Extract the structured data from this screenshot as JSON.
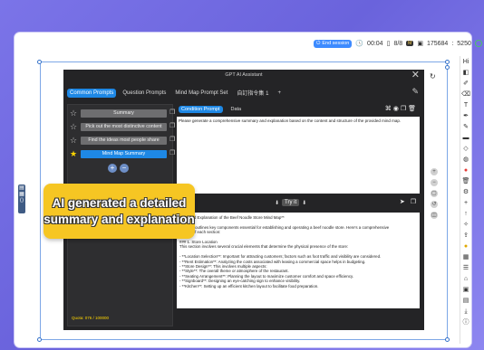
{
  "status_bar": {
    "end_label": "End session",
    "timer": "00:04",
    "pages": "8/8",
    "coin_label": "M",
    "credits": "175684",
    "sep": ":",
    "rate": "5250"
  },
  "app": {
    "title": "GPT AI Assistant",
    "tabs": [
      "Common Prompts",
      "Question Prompts",
      "Mind Map Prompt Set",
      "自訂指令集 1"
    ],
    "add_tab": "+",
    "prompts": [
      {
        "label": "Summary",
        "starred": false
      },
      {
        "label": "Pick out the most distinctive content",
        "starred": false
      },
      {
        "label": "Find the ideas most people share",
        "starred": false
      },
      {
        "label": "Mind Map Summary",
        "starred": true
      }
    ],
    "quota_text": "Quota: 076 / 100000",
    "right_tabs": [
      "Condition Prompt",
      "Data"
    ],
    "condition_text": "Please generate a comprehensive summary and explanation based on the content and structure of the provided mind map.",
    "try_it_label": "Try it",
    "result_lines": [
      "...ary and Explanation of the Beef Noodle Store Mind Map**",
      "",
      "...d map outlines key components essential for establishing and operating a beef noodle store. Here's a comprehensive",
      "...mary of each section:",
      "",
      "### 1. Store Location",
      "This section involves several crucial elements that determine the physical presence of the store:",
      "",
      "- **Location Selection**: Important for attracting customers; factors such as foot traffic and visibility are considered.",
      "- **Rent Estimation**: Analyzing the costs associated with leasing a commercial space helps in budgeting.",
      "- **Store Design**: This involves multiple aspects:",
      "   - **Style**: The overall theme or atmosphere of the restaurant.",
      "   - **Seating Arrangement**: Planning the layout to maximize customer comfort and space efficiency.",
      "   - **Signboard**: Designing an eye-catching sign to enhance visibility.",
      "   - **Kitchen**: Setting up an efficient kitchen layout to facilitate food preparation."
    ]
  },
  "callout": {
    "line1": "AI generated a detailed",
    "line2": "summary and explanation"
  },
  "colors": {
    "background": "#7b74e8",
    "accent_blue": "#1e88e5",
    "callout_yellow": "#f6c623",
    "app_dark": "#242426"
  }
}
